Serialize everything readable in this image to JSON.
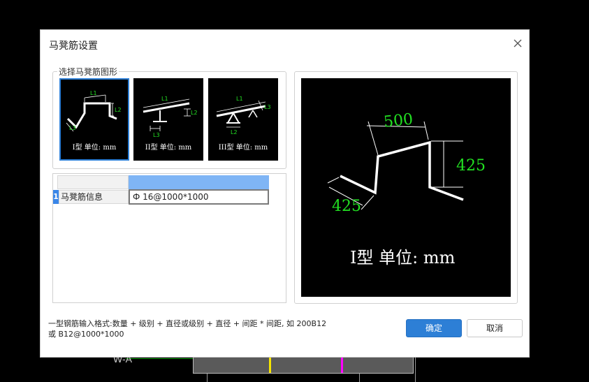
{
  "background": {
    "axis_label": "W-A",
    "colors": {
      "marker_yellow": "#f5e400",
      "marker_magenta": "#ff00ff",
      "grid_green": "#00a000"
    }
  },
  "dialog": {
    "title": "马凳筋设置",
    "close_icon": "close-icon",
    "shape_group": {
      "label": "选择马凳筋图形",
      "shapes": [
        {
          "caption": "I型 单位: mm",
          "labels": [
            "L1",
            "L2",
            "L3"
          ],
          "selected": true
        },
        {
          "caption": "II型 单位: mm",
          "labels": [
            "L1",
            "L2",
            "L3"
          ],
          "selected": false
        },
        {
          "caption": "III型 单位: mm",
          "labels": [
            "L1",
            "L2",
            "L3"
          ],
          "selected": false
        }
      ]
    },
    "grid": {
      "rows": [
        {
          "number": "1",
          "label": "马凳筋信息",
          "value": "Ф"
        }
      ],
      "value_full": "Ф 16@1000*1000"
    },
    "preview": {
      "dim_top": "500",
      "dim_right": "425",
      "dim_left": "425",
      "caption": "I型 单位: mm"
    },
    "hint_line1": "一型钢筋输入格式:数量 + 级别 + 直径或级别 + 直径 + 间距 * 间距, 如 200B12",
    "hint_line2": "或 B12@1000*1000",
    "ok_label": "确定",
    "cancel_label": "取消",
    "colors": {
      "accent": "#2d7fd6",
      "dimension_green": "#22e022",
      "header_blue": "#7fb5f5"
    }
  }
}
